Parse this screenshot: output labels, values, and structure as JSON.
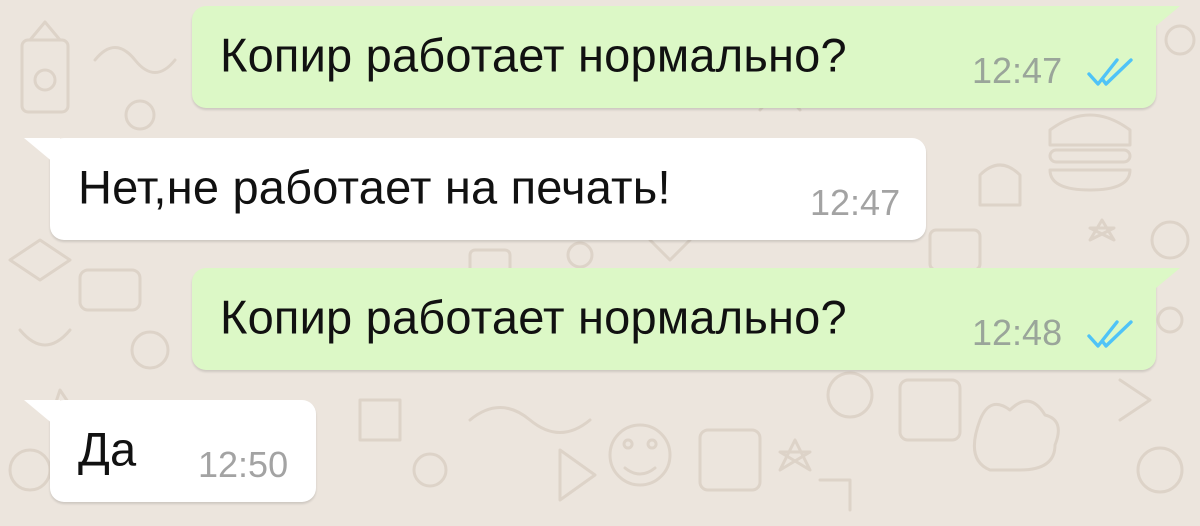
{
  "chat": {
    "messages": [
      {
        "direction": "out",
        "text": "Копир работает нормально?",
        "time": "12:47",
        "status_icon": "double-check-read-icon"
      },
      {
        "direction": "in",
        "text": "Нет,не работает на печать!",
        "time": "12:47"
      },
      {
        "direction": "out",
        "text": "Копир работает нормально?",
        "time": "12:48",
        "status_icon": "double-check-read-icon"
      },
      {
        "direction": "in",
        "text": "Да",
        "time": "12:50"
      }
    ]
  },
  "colors": {
    "chat_background": "#ece5dd",
    "outgoing_bubble": "#dcf8c6",
    "incoming_bubble": "#ffffff",
    "read_ticks": "#4fc3f7",
    "timestamp": "#9aa59a"
  }
}
